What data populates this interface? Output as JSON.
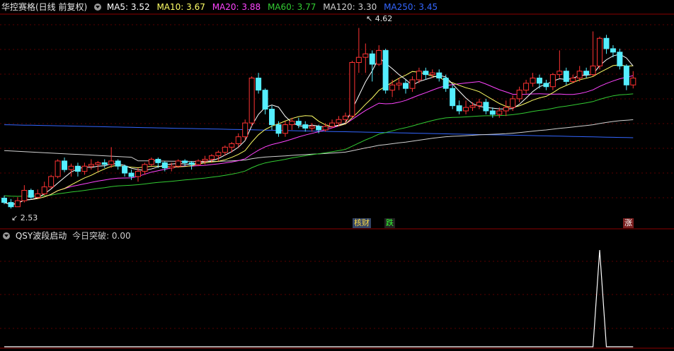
{
  "main_legend": {
    "title": "华控赛格(日线 前复权)",
    "ma": [
      {
        "label": "MA5: 3.52",
        "color": "#ffffff"
      },
      {
        "label": "MA10: 3.67",
        "color": "#ffff66"
      },
      {
        "label": "MA20: 3.88",
        "color": "#ff44ff"
      },
      {
        "label": "MA60: 3.77",
        "color": "#33cc33"
      },
      {
        "label": "MA120: 3.30",
        "color": "#d0d0d0"
      },
      {
        "label": "MA250: 3.45",
        "color": "#3366ff"
      }
    ]
  },
  "high_label": "4.62",
  "low_label": "2.53",
  "tags": [
    {
      "text": "核财",
      "color": "#ffdd44",
      "bg": "#334466"
    },
    {
      "text": "跌",
      "color": "#33ff33",
      "bg": "#222222"
    },
    {
      "text": "涨",
      "color": "#ffffff",
      "bg": "#7a1f1f"
    }
  ],
  "indicator_legend": {
    "title": "QSY波段启动",
    "value": "今日突破: 0.00"
  },
  "colors": {
    "up": "#ff3333",
    "down": "#55eeff",
    "axis": "#8b0000",
    "grid": "#5a0000",
    "ind_line": "#ffffff"
  },
  "chart_data": {
    "type": "candlestick",
    "title": "华控赛格(日线 前复权)",
    "ylim": [
      2.45,
      4.78
    ],
    "highest": 4.62,
    "lowest": 2.53,
    "candles": [
      [
        2.65,
        2.6,
        2.68,
        2.58
      ],
      [
        2.6,
        2.55,
        2.64,
        2.53
      ],
      [
        2.55,
        2.62,
        2.66,
        2.55
      ],
      [
        2.62,
        2.74,
        2.8,
        2.6
      ],
      [
        2.74,
        2.66,
        2.76,
        2.64
      ],
      [
        2.66,
        2.7,
        2.75,
        2.65
      ],
      [
        2.7,
        2.78,
        2.84,
        2.68
      ],
      [
        2.78,
        2.9,
        2.92,
        2.76
      ],
      [
        2.9,
        3.08,
        3.1,
        2.88
      ],
      [
        3.08,
        2.98,
        3.12,
        2.95
      ],
      [
        2.98,
        3.02,
        3.05,
        2.9
      ],
      [
        3.02,
        2.96,
        3.06,
        2.9
      ],
      [
        2.96,
        3.02,
        3.06,
        2.92
      ],
      [
        3.02,
        3.04,
        3.1,
        2.98
      ],
      [
        3.04,
        3.06,
        3.08,
        2.96
      ],
      [
        3.06,
        3.04,
        3.1,
        3.0
      ],
      [
        3.04,
        3.08,
        3.24,
        3.0
      ],
      [
        3.08,
        3.02,
        3.1,
        2.98
      ],
      [
        3.02,
        2.94,
        3.04,
        2.9
      ],
      [
        2.94,
        2.9,
        2.98,
        2.86
      ],
      [
        2.9,
        2.96,
        3.0,
        2.84
      ],
      [
        2.96,
        3.04,
        3.06,
        2.92
      ],
      [
        3.04,
        3.1,
        3.12,
        3.02
      ],
      [
        3.1,
        3.06,
        3.12,
        3.0
      ],
      [
        3.06,
        3.0,
        3.08,
        2.96
      ],
      [
        3.0,
        3.02,
        3.06,
        2.96
      ],
      [
        3.02,
        3.08,
        3.1,
        3.0
      ],
      [
        3.08,
        3.06,
        3.1,
        3.02
      ],
      [
        3.06,
        3.04,
        3.08,
        2.98
      ],
      [
        3.04,
        3.08,
        3.1,
        3.02
      ],
      [
        3.08,
        3.1,
        3.14,
        3.04
      ],
      [
        3.1,
        3.14,
        3.16,
        3.06
      ],
      [
        3.14,
        3.18,
        3.2,
        3.08
      ],
      [
        3.18,
        3.24,
        3.26,
        3.14
      ],
      [
        3.24,
        3.28,
        3.3,
        3.18
      ],
      [
        3.28,
        3.36,
        3.4,
        3.24
      ],
      [
        3.36,
        3.52,
        3.56,
        3.32
      ],
      [
        3.52,
        4.04,
        4.06,
        3.48
      ],
      [
        4.04,
        3.9,
        4.1,
        3.86
      ],
      [
        3.9,
        3.68,
        3.92,
        3.62
      ],
      [
        3.68,
        3.5,
        3.72,
        3.44
      ],
      [
        3.5,
        3.4,
        3.54,
        3.36
      ],
      [
        3.4,
        3.5,
        3.54,
        3.36
      ],
      [
        3.5,
        3.54,
        3.58,
        3.44
      ],
      [
        3.54,
        3.5,
        3.58,
        3.46
      ],
      [
        3.5,
        3.46,
        3.54,
        3.42
      ],
      [
        3.46,
        3.48,
        3.52,
        3.42
      ],
      [
        3.48,
        3.44,
        3.5,
        3.4
      ],
      [
        3.44,
        3.48,
        3.52,
        3.42
      ],
      [
        3.48,
        3.52,
        3.56,
        3.46
      ],
      [
        3.52,
        3.56,
        3.6,
        3.48
      ],
      [
        3.56,
        3.6,
        3.64,
        3.52
      ],
      [
        3.6,
        4.22,
        4.24,
        3.58
      ],
      [
        4.22,
        4.28,
        4.62,
        4.1
      ],
      [
        4.28,
        4.32,
        4.44,
        4.1
      ],
      [
        4.32,
        4.2,
        4.36,
        4.0
      ],
      [
        4.2,
        4.36,
        4.42,
        4.18
      ],
      [
        4.36,
        3.9,
        4.38,
        3.86
      ],
      [
        3.9,
        3.96,
        4.02,
        3.82
      ],
      [
        3.96,
        3.98,
        4.04,
        3.9
      ],
      [
        3.98,
        3.92,
        4.02,
        3.86
      ],
      [
        3.92,
        4.02,
        4.06,
        3.88
      ],
      [
        4.02,
        4.12,
        4.16,
        3.98
      ],
      [
        4.12,
        4.08,
        4.16,
        4.02
      ],
      [
        4.08,
        4.1,
        4.14,
        4.04
      ],
      [
        4.1,
        4.04,
        4.14,
        4.0
      ],
      [
        4.04,
        3.92,
        4.08,
        3.88
      ],
      [
        3.92,
        3.72,
        3.96,
        3.68
      ],
      [
        3.72,
        3.66,
        3.78,
        3.62
      ],
      [
        3.66,
        3.7,
        3.78,
        3.62
      ],
      [
        3.7,
        3.72,
        3.76,
        3.66
      ],
      [
        3.72,
        3.76,
        3.8,
        3.68
      ],
      [
        3.76,
        3.66,
        3.8,
        3.62
      ],
      [
        3.66,
        3.62,
        3.7,
        3.58
      ],
      [
        3.62,
        3.66,
        3.7,
        3.58
      ],
      [
        3.66,
        3.7,
        3.78,
        3.6
      ],
      [
        3.7,
        3.8,
        3.84,
        3.66
      ],
      [
        3.8,
        3.9,
        3.94,
        3.76
      ],
      [
        3.9,
        3.98,
        4.02,
        3.86
      ],
      [
        3.98,
        4.04,
        4.1,
        3.94
      ],
      [
        4.04,
        3.98,
        4.08,
        3.92
      ],
      [
        3.98,
        3.94,
        4.02,
        3.9
      ],
      [
        3.94,
        4.08,
        4.1,
        3.9
      ],
      [
        4.08,
        4.12,
        4.36,
        4.04
      ],
      [
        4.12,
        4.0,
        4.16,
        3.96
      ],
      [
        4.0,
        4.04,
        4.08,
        3.98
      ],
      [
        4.04,
        4.12,
        4.18,
        4.0
      ],
      [
        4.12,
        4.08,
        4.16,
        4.04
      ],
      [
        4.08,
        4.18,
        4.58,
        4.06
      ],
      [
        4.18,
        4.5,
        4.52,
        4.14
      ],
      [
        4.5,
        4.38,
        4.54,
        4.32
      ],
      [
        4.38,
        4.34,
        4.42,
        4.28
      ],
      [
        4.34,
        4.18,
        4.38,
        4.14
      ],
      [
        4.18,
        3.96,
        4.2,
        3.9
      ],
      [
        3.96,
        4.04,
        4.12,
        3.92
      ]
    ],
    "ma_periods": [
      5,
      10,
      20,
      60,
      120,
      250
    ],
    "ma_labels": [
      "MA5: 3.52",
      "MA10: 3.67",
      "MA20: 3.88",
      "MA60: 3.77",
      "MA120: 3.30",
      "MA250: 3.45"
    ],
    "ma250_start": 3.5,
    "ma120_start": 3.2,
    "indicator": {
      "name": "QSY波段启动",
      "values": [
        0,
        0,
        0,
        0,
        0,
        0,
        0,
        0,
        0,
        0,
        0,
        0,
        0,
        0,
        0,
        0,
        0,
        0,
        0,
        0,
        0,
        0,
        0,
        0,
        0,
        0,
        0,
        0,
        0,
        0,
        0,
        0,
        0,
        0,
        0,
        0,
        0,
        0,
        0,
        0,
        0,
        0,
        0,
        0,
        0,
        0,
        0,
        0,
        0,
        0,
        0,
        0,
        0,
        0,
        0,
        0,
        0,
        0,
        0,
        0,
        0,
        0,
        0,
        0,
        0,
        0,
        0,
        0,
        0,
        0,
        0,
        0,
        0,
        0,
        0,
        0,
        0,
        0,
        0,
        0,
        0,
        0,
        0,
        0,
        0,
        0,
        0,
        0,
        0,
        1,
        0,
        0,
        0,
        0,
        0
      ],
      "ylim": [
        0,
        1.08
      ]
    }
  }
}
